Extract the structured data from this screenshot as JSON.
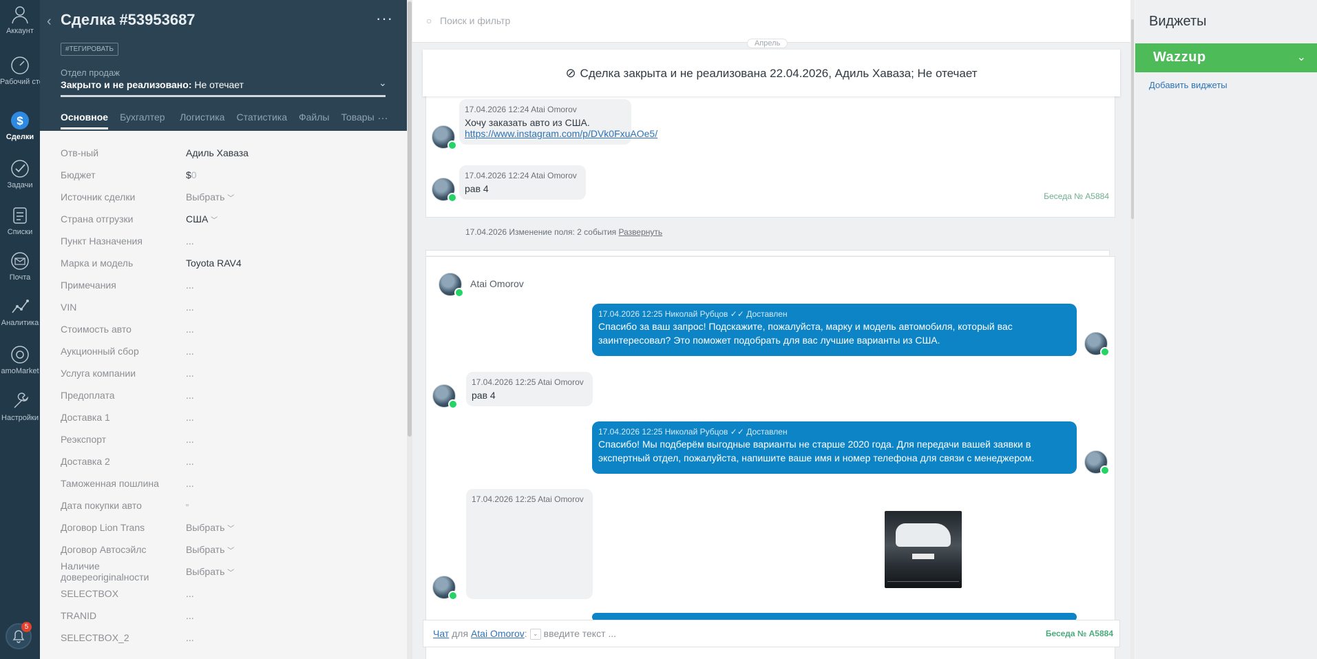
{
  "nav": {
    "items": [
      {
        "label": "Аккаунт",
        "icon": "user-icon"
      },
      {
        "label": "Рабочий стол",
        "icon": "dashboard-icon"
      },
      {
        "label": "Сделки",
        "icon": "deals-icon"
      },
      {
        "label": "Задачи",
        "icon": "tasks-icon"
      },
      {
        "label": "Списки",
        "icon": "lists-icon"
      },
      {
        "label": "Почта",
        "icon": "mail-icon"
      },
      {
        "label": "Аналитика",
        "icon": "analytics-icon"
      },
      {
        "label": "amoMarket",
        "icon": "market-icon"
      },
      {
        "label": "Настройки",
        "icon": "settings-icon"
      }
    ],
    "notifications_count": "5"
  },
  "deal": {
    "title": "Сделка #53953687",
    "tag_button": "#ТЕГИРОВАТЬ",
    "pipeline": "Отдел продаж",
    "status_bold": "Закрыто и не реализовано:",
    "status_reason": " Не отечает",
    "tabs": [
      "Основное",
      "Бухгалтер",
      "Логистика",
      "Статистика",
      "Файлы",
      "Товары"
    ],
    "tab_more": "…",
    "fields": [
      {
        "label": "Отв-ный",
        "value": "Адиль Хаваза"
      },
      {
        "label": "Бюджет",
        "value": "$",
        "value2": "0"
      },
      {
        "label": "Источник сделки",
        "value": "Выбрать",
        "select": true
      },
      {
        "label": "Страна отгрузки",
        "value": "США",
        "select": true
      },
      {
        "label": "Пункт Назначения",
        "value": "..."
      },
      {
        "label": "Марка и модель",
        "value": "Toyota RAV4"
      },
      {
        "label": "Примечания",
        "value": "..."
      },
      {
        "label": "VIN",
        "value": "..."
      },
      {
        "label": "Стоимость авто",
        "value": "..."
      },
      {
        "label": "Аукционный сбор",
        "value": "..."
      },
      {
        "label": "Услуга компании",
        "value": "..."
      },
      {
        "label": "Предоплата",
        "value": "..."
      },
      {
        "label": "Доставка 1",
        "value": "..."
      },
      {
        "label": "Реэкспорт",
        "value": "..."
      },
      {
        "label": "Доставка 2",
        "value": "..."
      },
      {
        "label": "Таможенная пошлина",
        "value": "..."
      },
      {
        "label": "Дата покупки авто",
        "value": "▫"
      },
      {
        "label": "Договор Lion Trans",
        "value": "Выбрать",
        "select": true
      },
      {
        "label": "Договор Автосэйлс",
        "value": "Выбрать",
        "select": true
      },
      {
        "label": "Наличие довереoriginalности",
        "value": "Выбрать",
        "select": true
      },
      {
        "label": "SELECTBOX",
        "value": "..."
      },
      {
        "label": "TRANID",
        "value": "..."
      },
      {
        "label": "SELECTBOX_2",
        "value": "..."
      }
    ]
  },
  "feed": {
    "search_placeholder": "Поиск и фильтр",
    "month": "Апрель",
    "closed_banner": "Сделка закрыта и не реализована 22.04.2026, Адиль Хаваза; Не отечает",
    "conv1": {
      "msg1_meta": "17.04.2026 12:24 Atai Omorov",
      "msg1_text": "Хочу заказать авто из США.",
      "msg1_link": "https://www.instagram.com/p/DVk0FxuAOe5/",
      "msg2_meta": "17.04.2026 12:24 Atai Omorov",
      "msg2_text": "рав 4",
      "conv_number": "Беседа № A5884"
    },
    "event": {
      "text": "17.04.2026 Изменение поля: 2 события ",
      "link": "Развернуть"
    },
    "conv2": {
      "contact": "Atai Omorov",
      "out1_meta": "17.04.2026 12:25 Николай Рубцов ✓✓ Доставлен",
      "out1_text": "Спасибо за ваш запрос! Подскажите, пожалуйста, марку и модель автомобиля, который вас заинтересовал? Это поможет подобрать для вас лучшие варианты из США.",
      "in1_meta": "17.04.2026 12:25 Atai Omorov",
      "in1_text": "рав 4",
      "out2_meta": "17.04.2026 12:25 Николай Рубцов ✓✓ Доставлен",
      "out2_text": "Спасибо! Мы подберём выгодные варианты не старше 2020 года. Для передачи вашей заявки в экспертный отдел, пожалуйста, напишите ваше имя и номер телефона для связи с менеджером.",
      "in2_meta": "17.04.2026 12:25 Atai Omorov"
    },
    "compose": {
      "chat": "Чат",
      "for": " для ",
      "contact": "Atai Omorov",
      "colon": ":",
      "placeholder": "введите текст ...",
      "conv_number": "Беседа № A5884"
    }
  },
  "widgets": {
    "title": "Виджеты",
    "wazzup": "Wazzup",
    "add": "Добавить виджеты"
  },
  "colors": {
    "nav_bg": "#22394a",
    "card_head_bg": "#2b4353",
    "outgoing_bubble": "#0d84c6",
    "wazzup_green": "#4dbb58",
    "link_blue": "#2f73b6"
  }
}
